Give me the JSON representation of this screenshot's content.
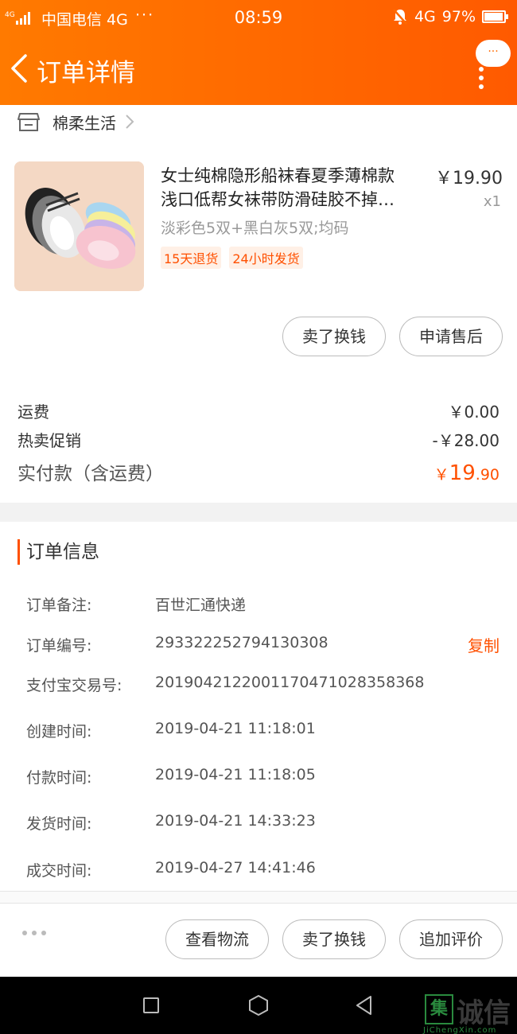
{
  "status_bar": {
    "signal_label": "4G",
    "carrier": "中国电信 4G",
    "dots": "···",
    "time": "08:59",
    "network": "4G",
    "battery": "97%"
  },
  "nav": {
    "title": "订单详情",
    "message_dots": "···"
  },
  "shop": {
    "name": "棉柔生活"
  },
  "product": {
    "title_line1": "女士纯棉隐形船袜春夏季薄棉款",
    "title_line2": "浅口低帮女袜带防滑硅胶不掉…",
    "price": "￥19.90",
    "quantity": "x1",
    "spec": "淡彩色5双+黑白灰5双;均码",
    "tags": [
      "15天退货",
      "24小时发货"
    ],
    "actions": [
      "卖了换钱",
      "申请售后"
    ]
  },
  "summary": {
    "shipping_label": "运费",
    "shipping_value": "￥0.00",
    "promo_label": "热卖促销",
    "promo_value": "-￥28.00",
    "total_label": "实付款（含运费）",
    "total_currency": "￥",
    "total_int": "19",
    "total_dec": ".90"
  },
  "order_info": {
    "title": "订单信息",
    "copy_label": "复制",
    "rows": [
      {
        "label": "订单备注:",
        "value": "百世汇通快递"
      },
      {
        "label": "订单编号:",
        "value": "293322252794130308"
      },
      {
        "label": "支付宝交易号:",
        "value": "2019042122001170471028358368"
      },
      {
        "label": "创建时间:",
        "value": "2019-04-21 11:18:01"
      },
      {
        "label": "付款时间:",
        "value": "2019-04-21 11:18:05"
      },
      {
        "label": "发货时间:",
        "value": "2019-04-21 14:33:23"
      },
      {
        "label": "成交时间:",
        "value": "2019-04-27 14:41:46"
      }
    ]
  },
  "bottom_bar": {
    "actions": [
      "查看物流",
      "卖了换钱",
      "追加评价"
    ]
  },
  "watermark": {
    "box_char": "集",
    "text": "诚信",
    "url": "JiChengXin.com"
  },
  "colors": {
    "brand": "#ff6a00",
    "accent": "#ff5000"
  }
}
